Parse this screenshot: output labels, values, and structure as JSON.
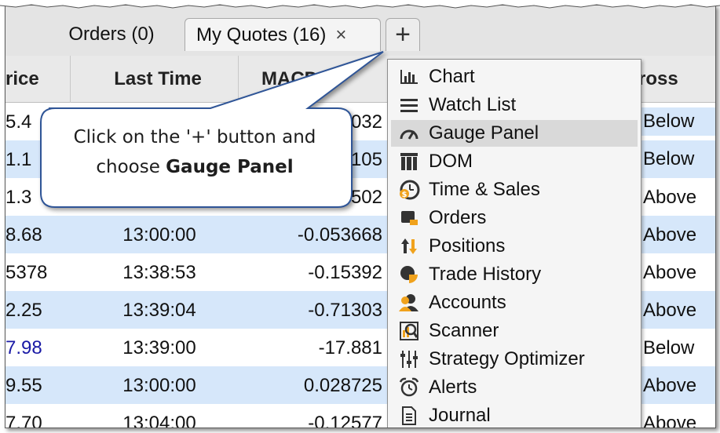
{
  "tabs": {
    "orders_label": "Orders (0)",
    "quotes_label": "My Quotes (16)",
    "close_glyph": "×",
    "add_glyph": "+"
  },
  "columns": {
    "price": "rice",
    "last_time": "Last Time",
    "macd": "MACD-M",
    "cross": "ross"
  },
  "rows": [
    {
      "price": "5.4",
      "time": "",
      "macd": "032",
      "cross": "Below",
      "alt": false
    },
    {
      "price": "1.1",
      "time": "",
      "macd": "105",
      "cross": "Below",
      "alt": true
    },
    {
      "price": "1.3",
      "time": "",
      "macd": "502",
      "cross": "Above",
      "alt": false
    },
    {
      "price": "8.68",
      "time": "13:00:00",
      "macd": "-0.053668",
      "cross": "Above",
      "alt": true
    },
    {
      "price": "5378",
      "time": "13:38:53",
      "macd": "-0.15392",
      "cross": "Above",
      "alt": false
    },
    {
      "price": "2.25",
      "time": "13:39:04",
      "macd": "-0.71303",
      "cross": "Above",
      "alt": true
    },
    {
      "price": "7.98",
      "time": "13:39:00",
      "macd": "-17.881",
      "cross": "Below",
      "alt": false,
      "blue": true
    },
    {
      "price": "9.55",
      "time": "13:00:00",
      "macd": "0.028725",
      "cross": "Above",
      "alt": true
    },
    {
      "price": "7.70",
      "time": "13:04:00",
      "macd": "-0.12577",
      "cross": "Above",
      "alt": false
    }
  ],
  "callout": {
    "line1": "Click on the '+' button and",
    "line2_prefix": "choose ",
    "line2_bold": "Gauge Panel"
  },
  "menu": {
    "items": [
      {
        "label": "Chart",
        "icon": "bar-chart-icon"
      },
      {
        "label": "Watch List",
        "icon": "list-icon"
      },
      {
        "label": "Gauge Panel",
        "icon": "gauge-icon",
        "active": true
      },
      {
        "label": "DOM",
        "icon": "dom-icon"
      },
      {
        "label": "Time & Sales",
        "icon": "time-sales-icon"
      },
      {
        "label": "Orders",
        "icon": "orders-icon"
      },
      {
        "label": "Positions",
        "icon": "positions-icon"
      },
      {
        "label": "Trade History",
        "icon": "trade-history-icon"
      },
      {
        "label": "Accounts",
        "icon": "accounts-icon"
      },
      {
        "label": "Scanner",
        "icon": "scanner-icon"
      },
      {
        "label": "Strategy Optimizer",
        "icon": "strategy-optimizer-icon"
      },
      {
        "label": "Alerts",
        "icon": "alarm-clock-icon"
      },
      {
        "label": "Journal",
        "icon": "journal-icon"
      }
    ]
  },
  "colors": {
    "row_alt": "#d6e7fa",
    "menu_highlight": "#d9d9d9",
    "callout_fill": "#ffffff",
    "callout_border": "#2f5597",
    "blue_text": "#1a1aa6",
    "accent_orange": "#f0a21c"
  }
}
